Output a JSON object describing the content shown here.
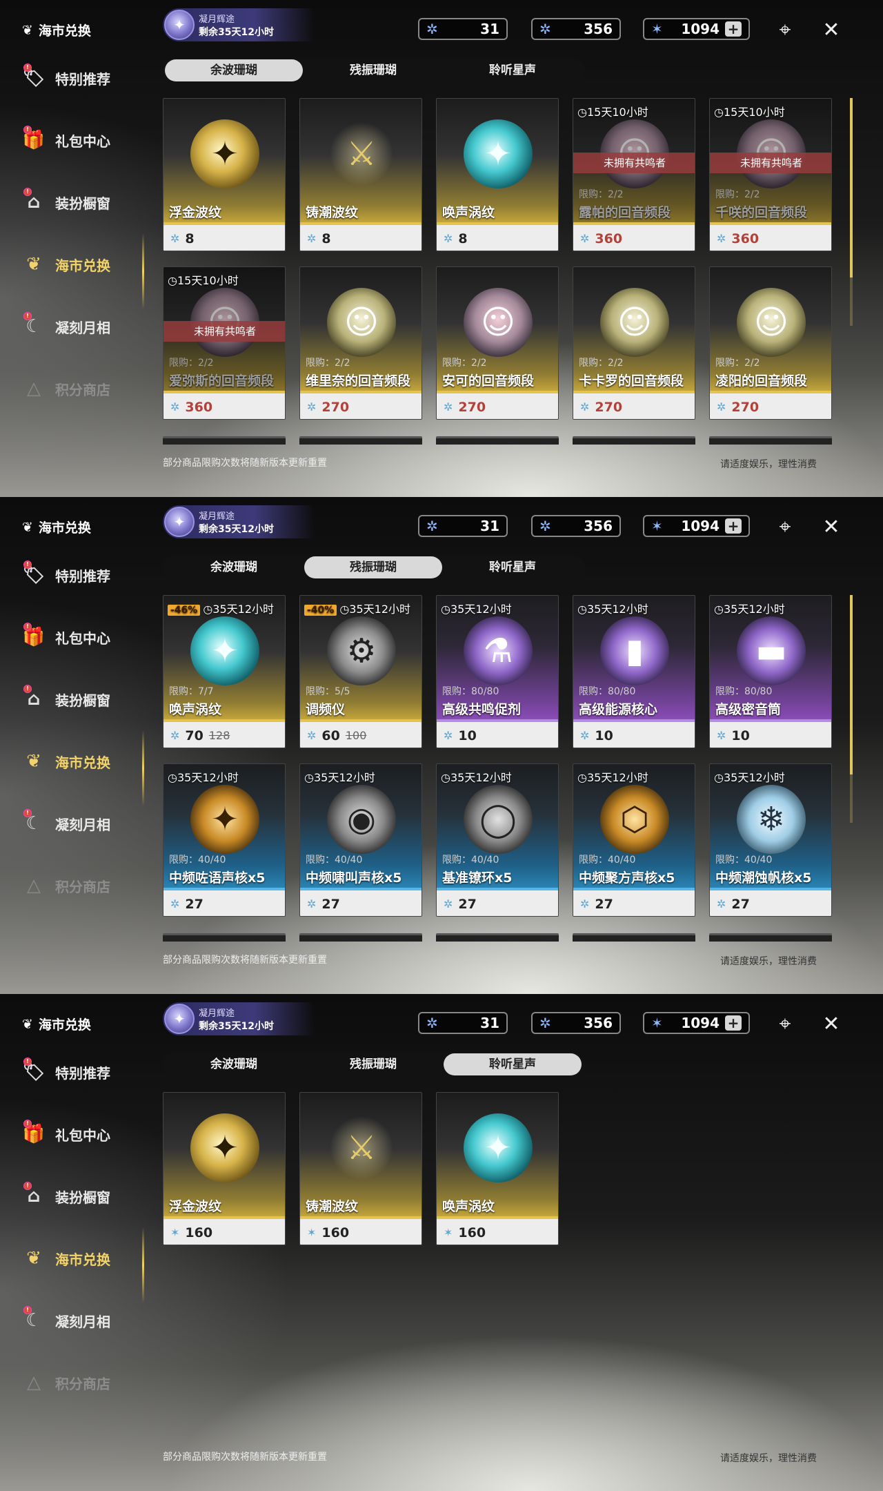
{
  "sidebar": {
    "title": "海市兑换",
    "items": [
      {
        "label": "特别推荐",
        "icon": "featured-icon"
      },
      {
        "label": "礼包中心",
        "icon": "gift-icon"
      },
      {
        "label": "装扮橱窗",
        "icon": "outfit-icon"
      },
      {
        "label": "海市兑换",
        "icon": "coral-icon"
      },
      {
        "label": "凝刻月相",
        "icon": "moon-icon"
      },
      {
        "label": "积分商店",
        "icon": "points-icon"
      }
    ]
  },
  "event": {
    "title": "凝月辉途",
    "remaining": "剩余35天12小时"
  },
  "currency": [
    {
      "icon": "afterglow-coral-icon",
      "value": "31"
    },
    {
      "icon": "oscillated-coral-icon",
      "value": "356"
    },
    {
      "icon": "lustrous-tide-icon",
      "value": "1094"
    }
  ],
  "tabs": [
    "余波珊瑚",
    "残振珊瑚",
    "聆听星声"
  ],
  "footer": {
    "note": "部分商品限购次数将随新版本更新重置",
    "advisory": "请适度娱乐，理性消费"
  },
  "panels": [
    {
      "active_tab": 0,
      "cards": [
        {
          "name": "浮金波纹",
          "price": "8"
        },
        {
          "name": "铸潮波纹",
          "price": "8"
        },
        {
          "name": "唤声涡纹",
          "price": "8"
        },
        {
          "timer": "15天10小时",
          "owner_badge": "未拥有共鸣者",
          "limit": "限购：2/2",
          "name": "露帕的回音频段",
          "price": "360"
        },
        {
          "timer": "15天10小时",
          "owner_badge": "未拥有共鸣者",
          "limit": "限购：2/2",
          "name": "千咲的回音频段",
          "price": "360"
        },
        {
          "timer": "15天10小时",
          "owner_badge": "未拥有共鸣者",
          "limit": "限购：2/2",
          "name": "爱弥斯的回音频段",
          "price": "360"
        },
        {
          "limit": "限购：2/2",
          "name": "维里奈的回音频段",
          "price": "270"
        },
        {
          "limit": "限购：2/2",
          "name": "安可的回音频段",
          "price": "270"
        },
        {
          "limit": "限购：2/2",
          "name": "卡卡罗的回音频段",
          "price": "270"
        },
        {
          "limit": "限购：2/2",
          "name": "凌阳的回音频段",
          "price": "270"
        }
      ]
    },
    {
      "active_tab": 1,
      "cards": [
        {
          "discount": "-46%",
          "timer": "35天12小时",
          "limit": "限购：7/7",
          "name": "唤声涡纹",
          "price": "70",
          "old_price": "128"
        },
        {
          "discount": "-40%",
          "timer": "35天12小时",
          "limit": "限购：5/5",
          "name": "调频仪",
          "price": "60",
          "old_price": "100"
        },
        {
          "timer": "35天12小时",
          "limit": "限购：80/80",
          "name": "高级共鸣促剂",
          "price": "10"
        },
        {
          "timer": "35天12小时",
          "limit": "限购：80/80",
          "name": "高级能源核心",
          "price": "10"
        },
        {
          "timer": "35天12小时",
          "limit": "限购：80/80",
          "name": "高级密音筒",
          "price": "10"
        },
        {
          "timer": "35天12小时",
          "limit": "限购：40/40",
          "name": "中频咗语声核x5",
          "price": "27"
        },
        {
          "timer": "35天12小时",
          "limit": "限购：40/40",
          "name": "中频啸叫声核x5",
          "price": "27"
        },
        {
          "timer": "35天12小时",
          "limit": "限购：40/40",
          "name": "基准镣环x5",
          "price": "27"
        },
        {
          "timer": "35天12小时",
          "limit": "限购：40/40",
          "name": "中频聚方声核x5",
          "price": "27"
        },
        {
          "timer": "35天12小时",
          "limit": "限购：40/40",
          "name": "中频潮蚀帆核x5",
          "price": "27"
        }
      ]
    },
    {
      "active_tab": 2,
      "cards": [
        {
          "name": "浮金波纹",
          "price": "160"
        },
        {
          "name": "铸潮波纹",
          "price": "160"
        },
        {
          "name": "唤声涡纹",
          "price": "160"
        }
      ]
    }
  ],
  "colors": {
    "accent_gold": "#f2d36a",
    "owner_badge": "#963c3c",
    "discount": "#f0a92c",
    "price_red": "#b3413a"
  }
}
